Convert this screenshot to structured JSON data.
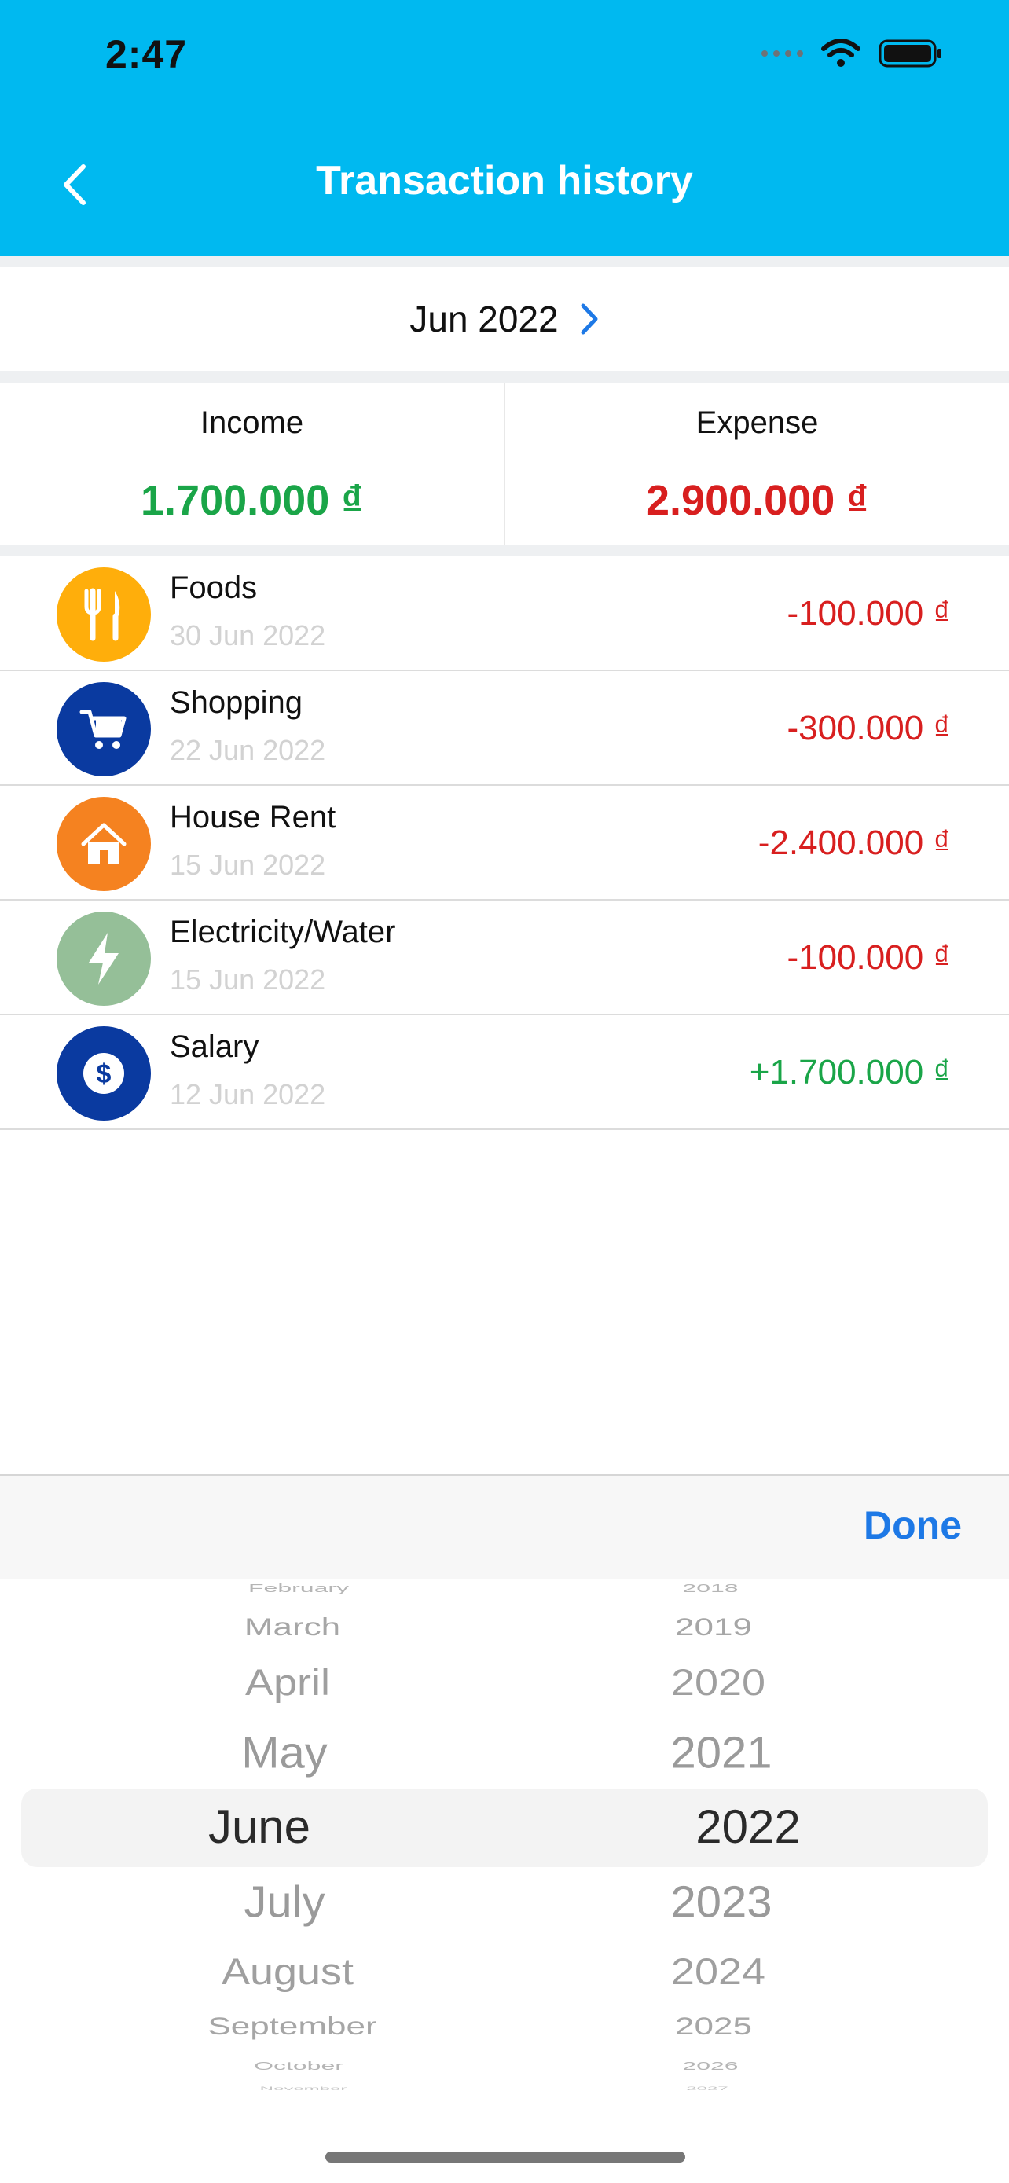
{
  "status_bar": {
    "time": "2:47"
  },
  "nav": {
    "title": "Transaction history"
  },
  "month_selector": {
    "label": "Jun 2022"
  },
  "summary": {
    "income_label": "Income",
    "income_value": "1.700.000 ₫",
    "expense_label": "Expense",
    "expense_value": "2.900.000 ₫"
  },
  "transactions": [
    {
      "category": "Foods",
      "date": "30 Jun 2022",
      "amount": "-100.000 ₫",
      "icon": "fork-knife-icon",
      "color": "#ffae0b"
    },
    {
      "category": "Shopping",
      "date": "22 Jun 2022",
      "amount": "-300.000 ₫",
      "icon": "shopping-cart-icon",
      "color": "#0a3aa0"
    },
    {
      "category": "House Rent",
      "date": "15 Jun 2022",
      "amount": "-2.400.000 ₫",
      "icon": "house-icon",
      "color": "#f58220"
    },
    {
      "category": "Electricity/Water",
      "date": "15 Jun 2022",
      "amount": "-100.000 ₫",
      "icon": "lightning-icon",
      "color": "#95bf98"
    },
    {
      "category": "Salary",
      "date": "12 Jun 2022",
      "amount": "+1.700.000 ₫",
      "icon": "dollar-icon",
      "color": "#0a3aa0"
    }
  ],
  "picker": {
    "done_label": "Done",
    "months": [
      "February",
      "March",
      "April",
      "May",
      "June",
      "July",
      "August",
      "September",
      "October",
      "November"
    ],
    "years": [
      "2018",
      "2019",
      "2020",
      "2021",
      "2022",
      "2023",
      "2024",
      "2025",
      "2026",
      "2027"
    ],
    "selected_month": "June",
    "selected_year": "2022"
  },
  "colors": {
    "header": "#00b9f0",
    "income": "#1aa548",
    "expense": "#d81f1f",
    "accent": "#1e79e6"
  }
}
